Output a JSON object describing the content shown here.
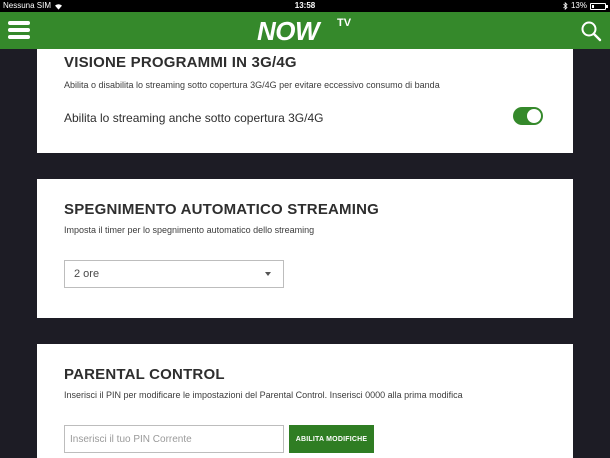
{
  "status_bar": {
    "carrier": "Nessuna SIM",
    "time": "13:58",
    "battery": "13%",
    "battery_level": 0.13
  },
  "header": {
    "logo_main": "NOW",
    "logo_sub": "TV",
    "brand_color": "#35892b"
  },
  "streaming_3g": {
    "title": "VISIONE PROGRAMMI IN 3G/4G",
    "description": "Abilita o disabilita lo streaming sotto copertura 3G/4G per evitare eccessivo consumo di banda",
    "toggle_label": "Abilita lo streaming anche sotto copertura 3G/4G",
    "toggle_on": true
  },
  "auto_shutdown": {
    "title": "SPEGNIMENTO AUTOMATICO STREAMING",
    "description": "Imposta il timer per lo spegnimento automatico dello streaming",
    "selected_value": "2 ore"
  },
  "parental_control": {
    "title": "PARENTAL CONTROL",
    "description": "Inserisci il PIN per modificare le impostazioni del Parental Control. Inserisci 0000 alla prima modifica",
    "pin_placeholder": "Inserisci il tuo PIN Corrente",
    "pin_value": "",
    "button_label": "ABILITA MODIFICHE"
  }
}
